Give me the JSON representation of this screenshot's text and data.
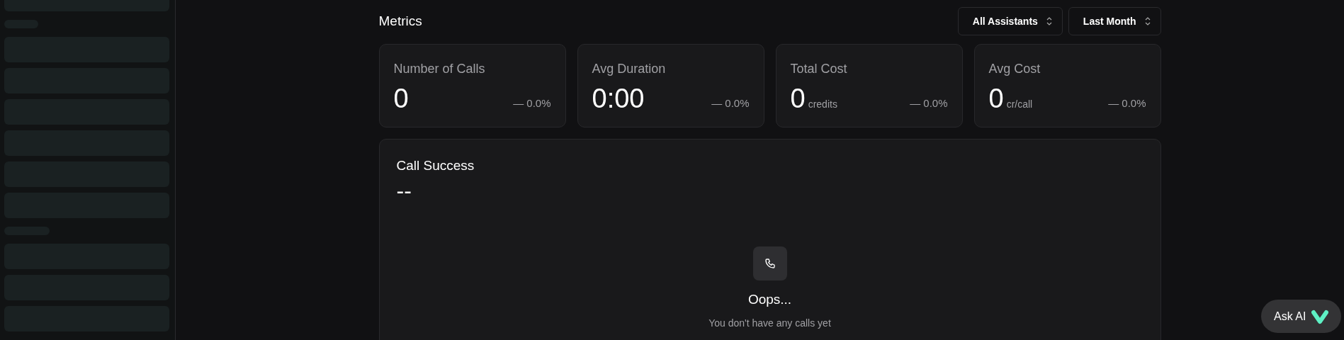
{
  "header": {
    "title": "Metrics",
    "filters": [
      {
        "label": "All Assistants"
      },
      {
        "label": "Last Month"
      }
    ]
  },
  "metrics": [
    {
      "label": "Number of Calls",
      "value": "0",
      "change": "— 0.0%"
    },
    {
      "label": "Avg Duration",
      "value": "0:00",
      "change": "— 0.0%"
    },
    {
      "label": "Total Cost",
      "value": "0",
      "unit": "credits",
      "change": "— 0.0%"
    },
    {
      "label": "Avg Cost",
      "value": "0",
      "unit": "cr/call",
      "change": "— 0.0%"
    }
  ],
  "call_success": {
    "title": "Call Success",
    "value": "--",
    "empty_title": "Oops...",
    "empty_message": "You don't have any calls yet"
  },
  "ask_ai": {
    "label": "Ask AI"
  }
}
